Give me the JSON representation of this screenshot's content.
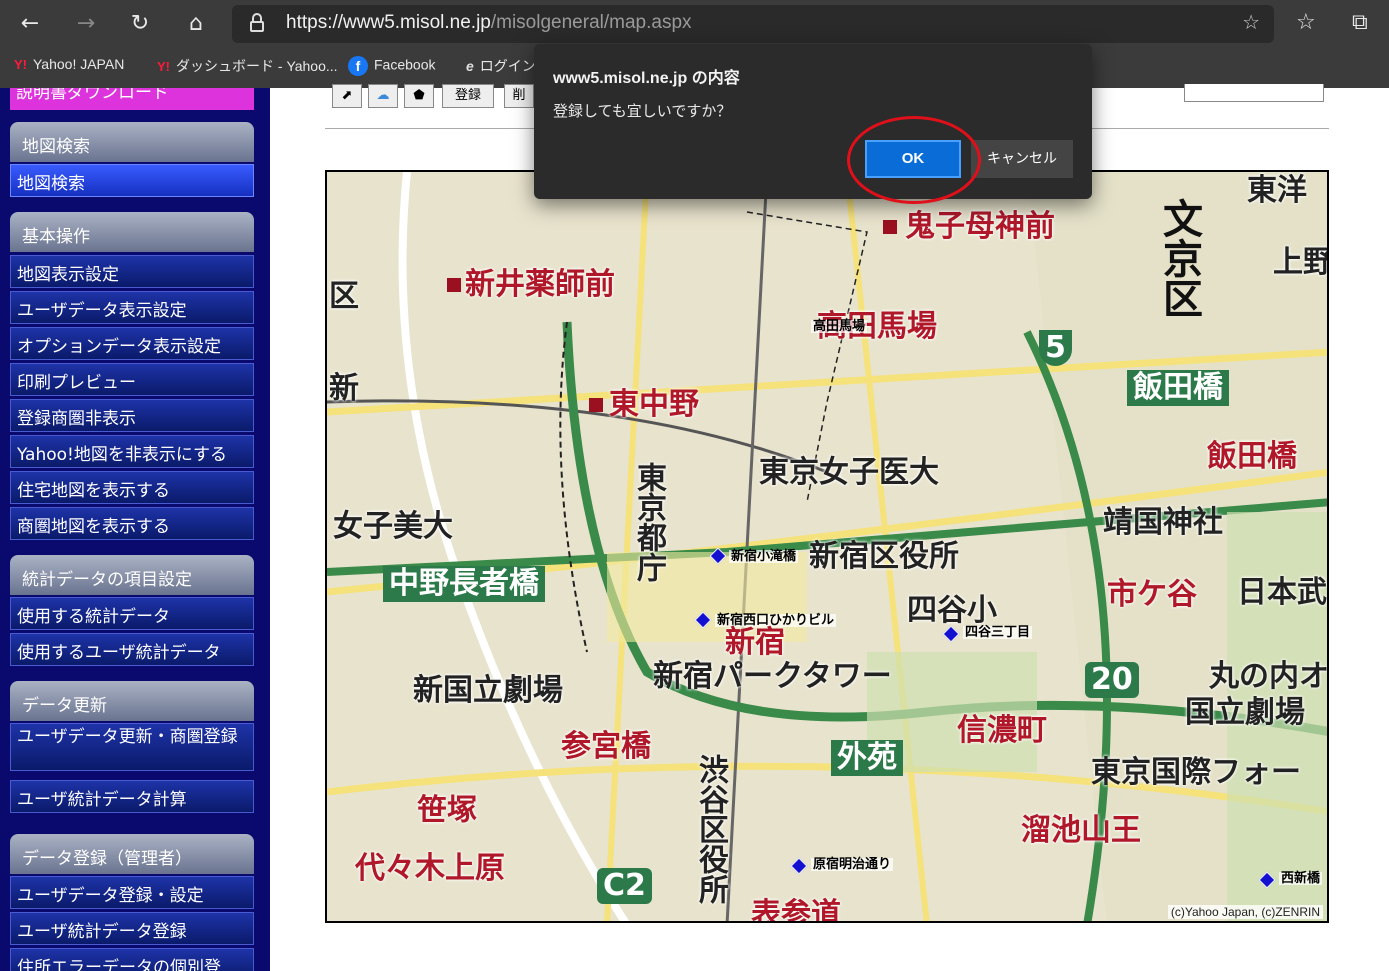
{
  "browser": {
    "url_host": "https://www5.misol.ne.jp",
    "url_path": "/misolgeneral/map.aspx",
    "bookmarks": [
      "Yahoo! JAPAN",
      "ダッシュボード - Yahoo...",
      "Facebook",
      "ログイン"
    ]
  },
  "sidebar": {
    "top_item": "説明書ダウンロード",
    "sections": [
      {
        "header": "地図検索",
        "items": [
          "地図検索"
        ]
      },
      {
        "header": "基本操作",
        "items": [
          "地図表示設定",
          "ユーザデータ表示設定",
          "オプションデータ表示設定",
          "印刷プレビュー",
          "登録商圏非表示",
          "Yahoo!地図を非表示にする",
          "住宅地図を表示する",
          "商圏地図を表示する"
        ]
      },
      {
        "header": "統計データの項目設定",
        "items": [
          "使用する統計データ",
          "使用するユーザ統計データ"
        ]
      },
      {
        "header": "データ更新",
        "items": [
          "ユーザデータ更新・商圏登録",
          "ユーザ統計データ計算"
        ]
      },
      {
        "header": "データ登録（管理者）",
        "items": [
          "ユーザデータ登録・設定",
          "ユーザ統計データ登録",
          "住所エラーデータの個別登"
        ]
      }
    ]
  },
  "toolbar": {
    "register_label": "登録",
    "delete_label": "削"
  },
  "map": {
    "labels": {
      "kishimojin": "鬼子母神前",
      "shin_iyakushi": "新井薬師前",
      "takadanobaba_st": "高田馬場",
      "takadanobaba_big": "高田馬場",
      "higashinakano": "東中野",
      "iidabashi_green": "飯田橋",
      "iidabashi_red": "飯田橋",
      "tokyo_joshi": "東京女子医大",
      "joshibi": "女子美大",
      "yasukuni": "靖国神社",
      "nakano_choja": "中野長者橋",
      "tokyo_tocho": "東京都庁",
      "shinjuku_kuyakusho": "新宿区役所",
      "shinjuku_kotakibashi": "新宿小滝橋",
      "ichigaya": "市ケ谷",
      "shinjuku_nishiguchi": "新宿西口ひかりビル",
      "shinjuku": "新宿",
      "yotsuya_sho": "四谷小",
      "yotsuya_3": "四谷三丁目",
      "shinkokuritsu": "新国立劇場",
      "park_tower": "新宿パークタワー",
      "shinanomachi": "信濃町",
      "sangubashi": "参宮橋",
      "gaien": "外苑",
      "shibuya_kuyakusho": "渋谷区役所",
      "sasazuka": "笹塚",
      "yoyogi_uehara": "代々木上原",
      "harajuku_meiji": "原宿明治通り",
      "tameike": "溜池山王",
      "omotesando": "表参道",
      "bunkyo": "文京区",
      "route5": "5",
      "route20": "20",
      "c2": "C2",
      "tokyo_kokusai": "東京国際フォー",
      "marunouchi": "丸の内オ",
      "kokuritsu": "国立劇場",
      "nippon_budo": "日本武",
      "nishi": "西新橋",
      "higashi": "東洋",
      "ueno": "上野",
      "ku": "区",
      "shin": "新"
    },
    "copyright": "(c)Yahoo Japan, (c)ZENRIN"
  },
  "dialog": {
    "title": "www5.misol.ne.jp の内容",
    "message": "登録しても宜しいですか？",
    "ok_label": "OK",
    "cancel_label": "キャンセル"
  }
}
